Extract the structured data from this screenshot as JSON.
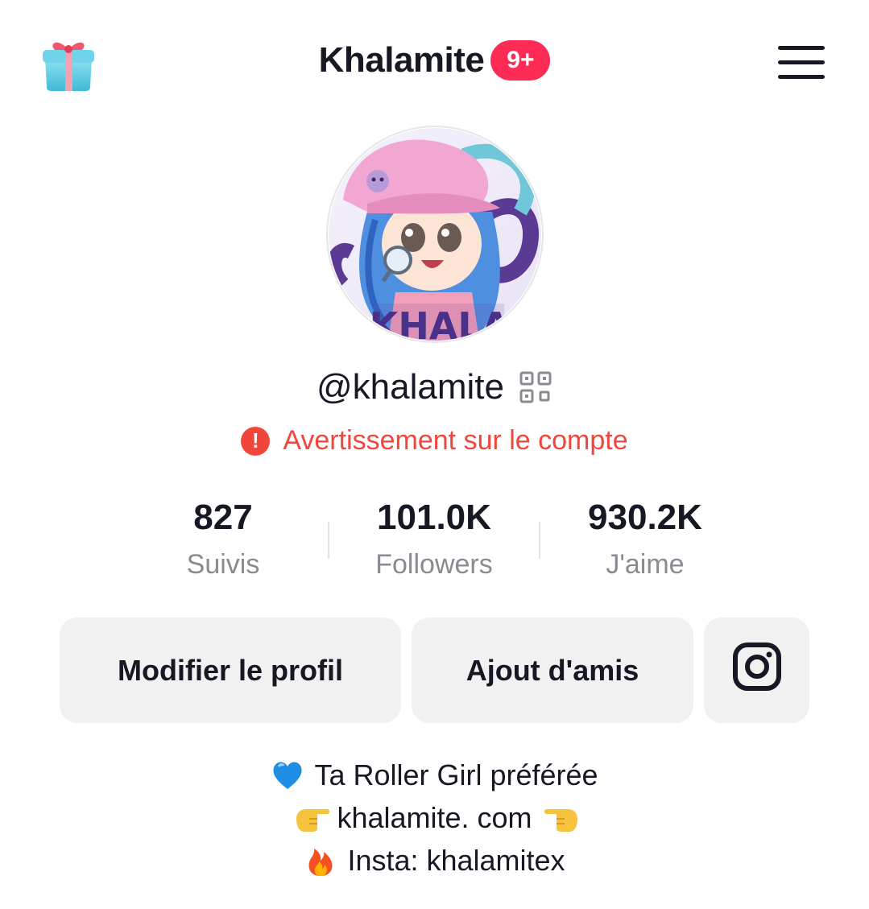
{
  "header": {
    "gift_icon": "gift-icon",
    "title": "Khalamite",
    "notification_badge": "9+",
    "menu_icon": "hamburger-menu-icon"
  },
  "profile": {
    "avatar": "profile-avatar-image",
    "username": "@khalamite",
    "qr_icon": "qr-code-icon",
    "warning_text": "Avertissement sur le compte",
    "warning_icon": "exclamation-circle-icon"
  },
  "stats": [
    {
      "value": "827",
      "label": "Suivis"
    },
    {
      "value": "101.0K",
      "label": "Followers"
    },
    {
      "value": "930.2K",
      "label": "J'aime"
    }
  ],
  "actions": {
    "edit_profile": "Modifier le profil",
    "add_friends": "Ajout d'amis",
    "instagram_icon": "instagram-icon"
  },
  "bio": {
    "line1": "Ta Roller Girl préférée",
    "line2": "khalamite. com",
    "line3": "Insta: khalamitex"
  },
  "colors": {
    "badge": "#fe2c55",
    "warning": "#f0463c",
    "text": "#161823",
    "muted": "#8a8b91",
    "button_bg": "#f1f1f2"
  }
}
